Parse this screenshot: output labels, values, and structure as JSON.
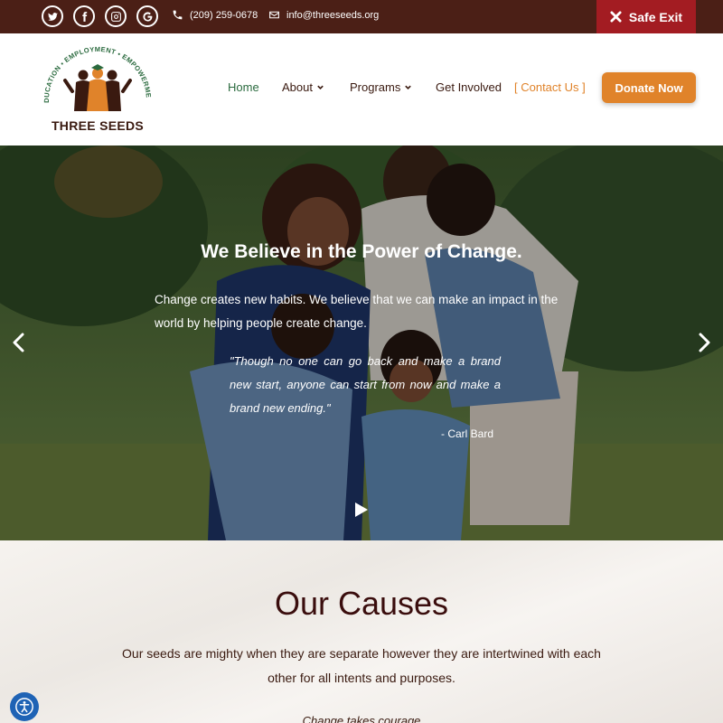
{
  "topbar": {
    "social": [
      {
        "name": "twitter-icon"
      },
      {
        "name": "facebook-icon"
      },
      {
        "name": "instagram-icon"
      },
      {
        "name": "google-icon"
      }
    ],
    "phone": "(209) 259-0678",
    "email": "info@threeseeds.org",
    "safe_exit_label": "Safe Exit",
    "colors": {
      "bar": "#4b1f16",
      "safe_exit": "#a31c22"
    }
  },
  "header": {
    "logo": {
      "name": "THREE SEEDS",
      "arc_text": "EDUCATION • EMPLOYMENT • EMPOWERMENT"
    },
    "nav": [
      {
        "label": "Home",
        "active": true
      },
      {
        "label": "About",
        "has_dropdown": true
      },
      {
        "label": "Programs",
        "has_dropdown": true
      },
      {
        "label": "Get Involved"
      },
      {
        "label": "[ Contact Us ]"
      }
    ],
    "donate_label": "Donate Now",
    "colors": {
      "accent": "#e0832a",
      "active": "#2a6a3e"
    }
  },
  "hero": {
    "title": "We Believe in the Power of Change.",
    "body": "Change creates new habits. We believe that we can make an impact in the world by helping people create change.",
    "quote": "\"Though no one can go back and make a brand new start, anyone can start from now and make a brand new ending.\"",
    "author": "- Carl Bard"
  },
  "causes": {
    "title": "Our Causes",
    "text": "Our seeds are mighty when they are separate however they are intertwined with each other for all intents and purposes.",
    "subtext": "Change takes courage"
  }
}
